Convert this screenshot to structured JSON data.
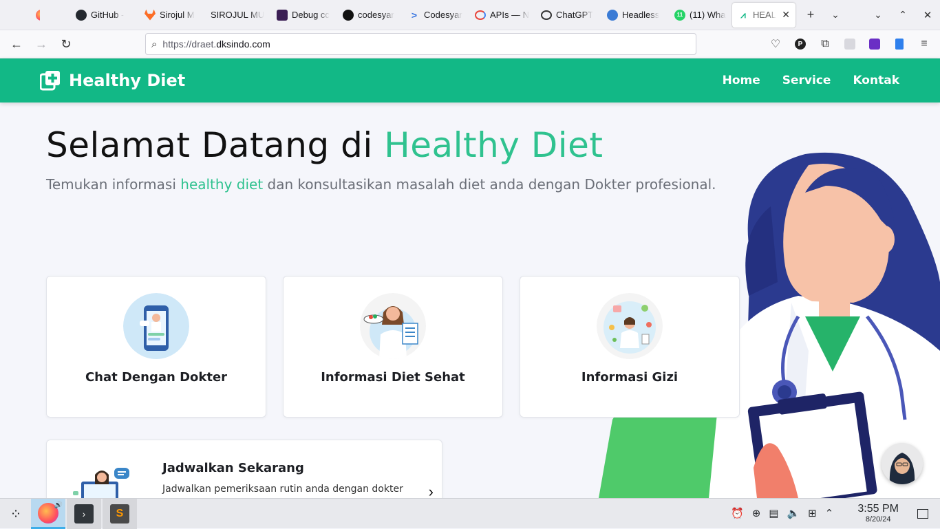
{
  "browser": {
    "tabs": [
      {
        "title": "",
        "icon": "firefox-icon",
        "color": "#ff7139"
      },
      {
        "title": "GitHub -",
        "icon": "github-icon",
        "color": "#24292f"
      },
      {
        "title": "Sirojul M",
        "icon": "gitlab-icon",
        "color": "#fc6d26"
      },
      {
        "title": "SIROJUL MU",
        "icon": "blank-icon",
        "color": "#f0f0f4"
      },
      {
        "title": "Debug cc",
        "icon": "debug-icon",
        "color": "#3b1e54"
      },
      {
        "title": "codesyar",
        "icon": "codesyar-icon",
        "color": "#111111"
      },
      {
        "title": "Codesyar",
        "icon": "codesyar-prompt-icon",
        "color": "#2f6fe0"
      },
      {
        "title": "APIs — N",
        "icon": "apis-icon",
        "color": "#ffffff"
      },
      {
        "title": "ChatGPT",
        "icon": "chatgpt-icon",
        "color": "#ffffff"
      },
      {
        "title": "Headless",
        "icon": "headless-icon",
        "color": "#3a7bd5"
      },
      {
        "title": "(11) Wha",
        "icon": "whatsapp-icon",
        "color": "#25d366"
      },
      {
        "title": "HEALT",
        "icon": "healthy-diet-icon",
        "color": "#12b886"
      }
    ],
    "new_tab": "+",
    "url_prefix": "https://draet.",
    "url_host": "dksindo.com"
  },
  "site": {
    "brand": "Healthy Diet",
    "menu": [
      "Home",
      "Service",
      "Kontak"
    ],
    "hero_title_prefix": "Selamat Datang di ",
    "hero_title_accent": "Healthy Diet",
    "hero_sub_prefix": "Temukan informasi ",
    "hero_sub_accent": "healthy diet",
    "hero_sub_suffix": " dan konsultasikan masalah diet anda dengan Dokter profesional.",
    "cards": [
      {
        "title": "Chat Dengan Dokter"
      },
      {
        "title": "Informasi Diet Sehat"
      },
      {
        "title": "Informasi Gizi"
      }
    ],
    "schedule": {
      "title": "Jadwalkan Sekarang",
      "desc": "Jadwalkan pemeriksaan rutin anda dengan dokter"
    },
    "colors": {
      "primary": "#12b886",
      "accent": "#2fc28f",
      "hair": "#2b3a8f",
      "skin": "#f7c2a8"
    }
  },
  "taskbar": {
    "time": "3:55 PM",
    "date": "8/20/24"
  }
}
